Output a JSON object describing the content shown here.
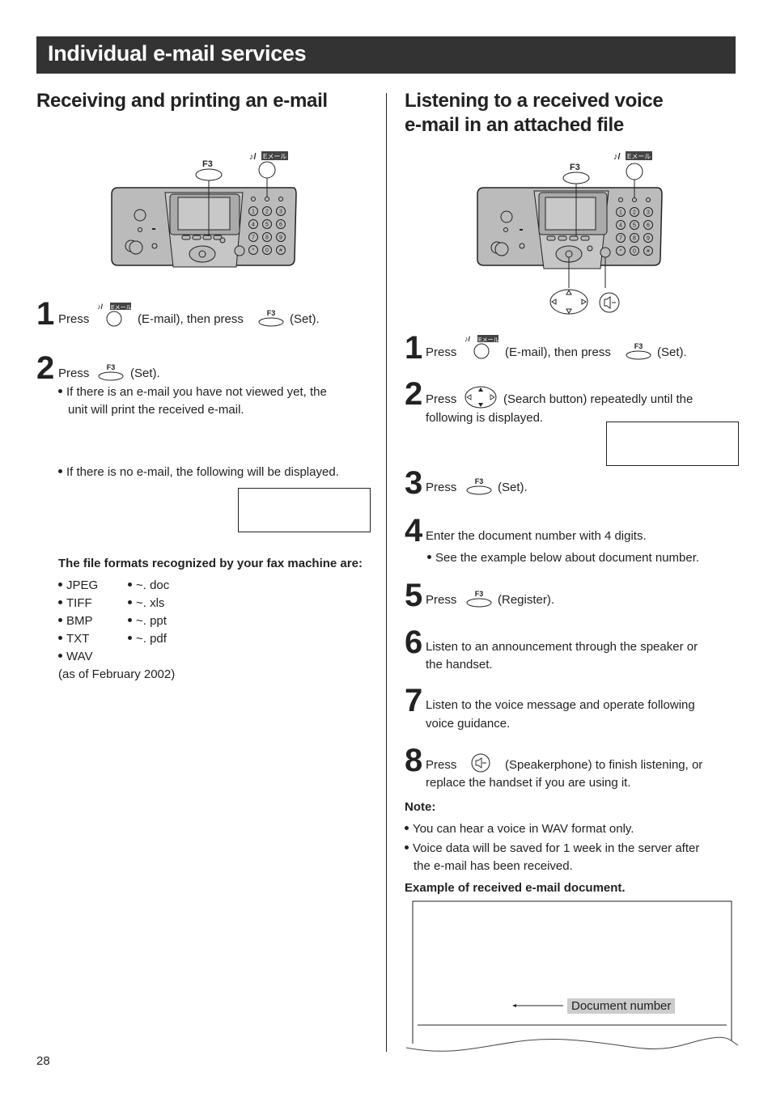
{
  "header": {
    "title": "Individual e-mail services"
  },
  "left": {
    "title": "Receiving and printing an e-mail",
    "device": {
      "f3_label": "F3",
      "email_label": "Eメール",
      "keypad": [
        "1",
        "2",
        "3",
        "4",
        "5",
        "6",
        "7",
        "8",
        "9",
        "*",
        "0",
        "#"
      ]
    },
    "steps": [
      {
        "num": "1",
        "press": "Press",
        "mid": "(E-mail), then press",
        "end": "(Set).",
        "key_label": "F3",
        "email_label": "Eメール"
      },
      {
        "num": "2",
        "press": "Press",
        "end": "(Set).",
        "key_label": "F3",
        "bullets": [
          "If there is an e-mail you have not viewed yet, the",
          "unit will print the received e-mail."
        ]
      }
    ],
    "no_email_bullet": "If there is no e-mail, the following will be displayed.",
    "display_box_text": "",
    "formats_heading": "The file formats recognized by your fax machine are:",
    "formats_col1": [
      "JPEG",
      "TIFF",
      "BMP",
      "TXT",
      "WAV"
    ],
    "formats_col2": [
      "~. doc",
      "~. xls",
      "~. ppt",
      "~. pdf"
    ],
    "formats_note": "(as of February 2002)"
  },
  "right": {
    "title_line1": "Listening to a received voice",
    "title_line2": "e-mail in an attached file",
    "device": {
      "f3_label": "F3",
      "email_label": "Eメール"
    },
    "steps": [
      {
        "num": "1",
        "press": "Press",
        "mid": "(E-mail), then press",
        "end": "(Set).",
        "key_label": "F3",
        "email_label": "Eメール"
      },
      {
        "num": "2",
        "press": "Press",
        "line1": "(Search button) repeatedly until the",
        "line2": "following is displayed."
      },
      {
        "num": "3",
        "press": "Press",
        "end": "(Set).",
        "key_label": "F3"
      },
      {
        "num": "4",
        "line1": "Enter the document number with 4 digits.",
        "bullet": "See the example below about document number."
      },
      {
        "num": "5",
        "press": "Press",
        "end": "(Register).",
        "key_label": "F3"
      },
      {
        "num": "6",
        "line1": "Listen to an announcement through the speaker or",
        "line2": "the handset."
      },
      {
        "num": "7",
        "line1": "Listen to the voice message and operate following",
        "line2": "voice guidance."
      },
      {
        "num": "8",
        "press": "Press",
        "line1": "(Speakerphone) to finish listening, or",
        "line2": "replace the handset if you are using it."
      }
    ],
    "note_heading": "Note:",
    "notes": [
      "You can hear a voice in WAV format only.",
      "Voice data will be saved for 1 week in the server after",
      "the e-mail has been received."
    ],
    "example_heading": "Example of received e-mail document.",
    "document_number_label": "Document number"
  },
  "footer": {
    "page_number": "28"
  }
}
